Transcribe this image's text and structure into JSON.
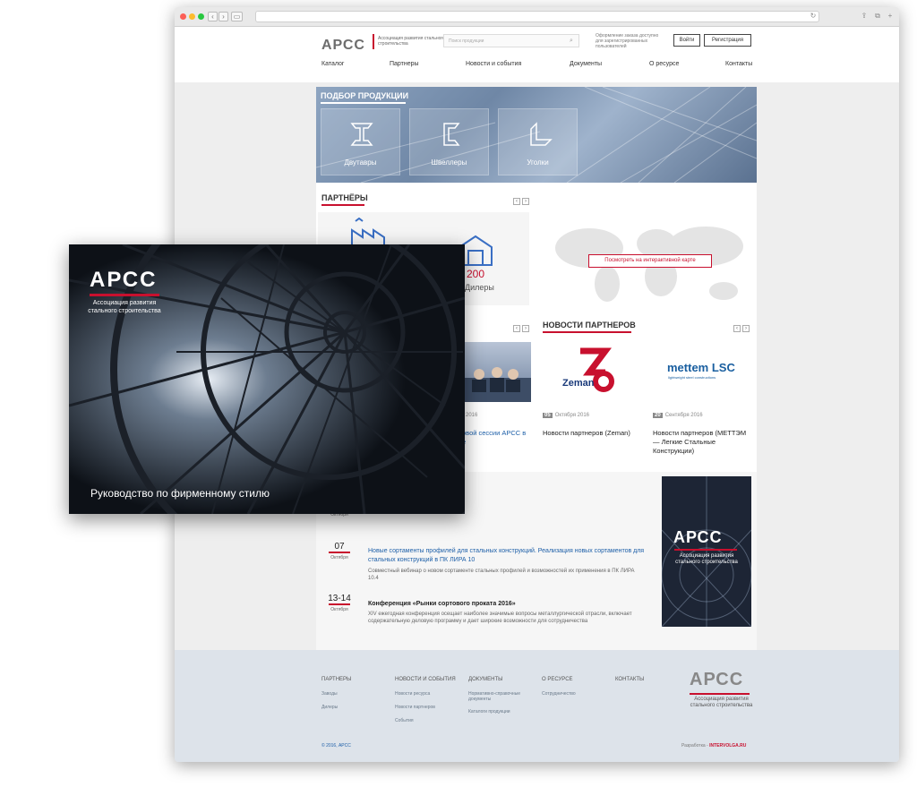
{
  "header": {
    "logo": "АРСС",
    "logo_sub": "Ассоциация развития стального строительства",
    "search_placeholder": "Поиск продукции",
    "order_note": "Оформление заказа доступно для зарегистрированных пользователей",
    "login_label": "Войти",
    "register_label": "Регистрация"
  },
  "menu": [
    "Каталог",
    "Партнеры",
    "Новости и события",
    "Документы",
    "О ресурсе",
    "Контакты"
  ],
  "products": {
    "title": "ПОДБОР ПРОДУКЦИИ",
    "tiles": [
      "Двутавры",
      "Швеллеры",
      "Уголки"
    ]
  },
  "partners": {
    "title": "ПАРТНЁРЫ",
    "dealers_count": "200",
    "dealers_label": "Дилеры",
    "map_button": "Посмотреть на интерактивной карте"
  },
  "partner_news": {
    "title": "НОВОСТИ ПАРТНЕРОВ",
    "left_item": {
      "date_partial": "2016",
      "title_partial": "овой сессии АРСС в",
      "title_partial2": "е"
    },
    "items": [
      {
        "day": "05",
        "date": "Октября 2016",
        "title": "Новости партнеров (Zeman)",
        "logo": "Zeman"
      },
      {
        "day": "20",
        "date": "Сентября 2016",
        "title": "Новости партнеров (МЕТТЭМ — Легкие Стальные Конструкции)",
        "logo": "mettem LSC",
        "logo_sub": "lightweight steel constructions"
      }
    ]
  },
  "events": [
    {
      "date_partial_month": "Октября"
    },
    {
      "date": "07",
      "month": "Октября",
      "title": "Новые сортаменты профилей для стальных конструкций. Реализация новых сортаментов для стальных конструкций в ПК ЛИРА 10",
      "desc": "Совместный вебинар о новом сортаменте стальных профилей и возможностей их применения в ПК ЛИРА 10.4"
    },
    {
      "date": "13-14",
      "month": "Октября",
      "title": "Конференция «Рынки сортового проката 2016»",
      "desc": "XIV ежегодная конференция осещает наиболее значимые вопросы металлургической отрасли, включает содержательную деловую программу и дает широкие возможности для сотрудничества"
    }
  ],
  "promo": {
    "logo": "АРСС",
    "sub": "Ассоциация развития стального строительства"
  },
  "footer": {
    "cols": [
      {
        "head": "ПАРТНЕРЫ",
        "links": [
          "Заводы",
          "Дилеры"
        ]
      },
      {
        "head": "НОВОСТИ И СОБЫТИЯ",
        "links": [
          "Новости ресурса",
          "Новости партнеров",
          "События"
        ]
      },
      {
        "head": "ДОКУМЕНТЫ",
        "links": [
          "Нормативно-справочные документы",
          "Каталоги продукции"
        ]
      },
      {
        "head": "О РЕСУРСЕ",
        "links": [
          "Сотрудничество"
        ]
      },
      {
        "head": "КОНТАКТЫ",
        "links": []
      }
    ],
    "logo": "АРСС",
    "logo_sub": "Ассоциация развития стального строительства",
    "copyright": "© 2016, АРСС",
    "dev_label": "Разработка -",
    "dev_name": "INTERVOLGA.RU"
  },
  "overlay": {
    "logo": "АРСС",
    "sub": "Ассоциация развития стального строительства",
    "caption": "Руководство по фирменному стилю"
  },
  "colors": {
    "accent": "#c8102e",
    "link": "#1d5fa8",
    "footer_bg": "#dde3ea",
    "dark": "#0d1117"
  }
}
